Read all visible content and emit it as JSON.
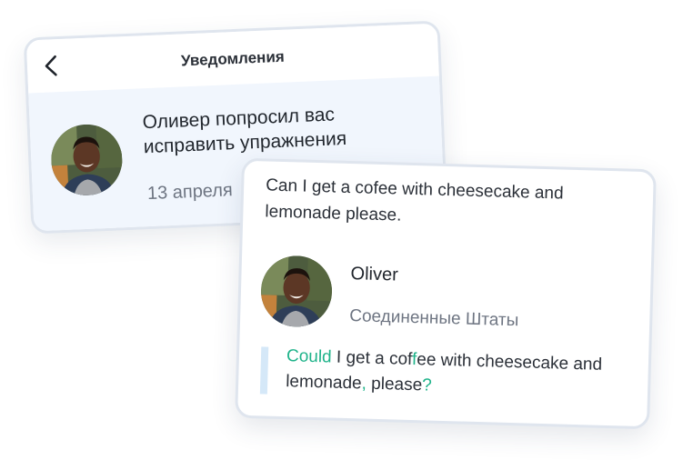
{
  "notification_card": {
    "title": "Уведомления",
    "message": "Оливер попросил вас исправить упражнения",
    "date": "13 апреля"
  },
  "correction_card": {
    "original_text": "Can I get a cofee with cheesecake and lemonade please.",
    "author": {
      "name": "Oliver",
      "country": "Соединенные Штаты"
    },
    "corrected_segments": [
      {
        "text": "Could",
        "highlight": true
      },
      {
        "text": " I get a cof",
        "highlight": false
      },
      {
        "text": "f",
        "highlight": true
      },
      {
        "text": "ee with cheesecake and lemonade",
        "highlight": false
      },
      {
        "text": ",",
        "highlight": true
      },
      {
        "text": " please",
        "highlight": false
      },
      {
        "text": "?",
        "highlight": true
      }
    ]
  },
  "colors": {
    "highlight": "#1fb38a",
    "card_border": "#dfe5ee",
    "notification_body_bg": "#f1f6fd",
    "correction_bar": "#d5e8f8"
  },
  "icons": {
    "back": "chevron-left-icon"
  }
}
